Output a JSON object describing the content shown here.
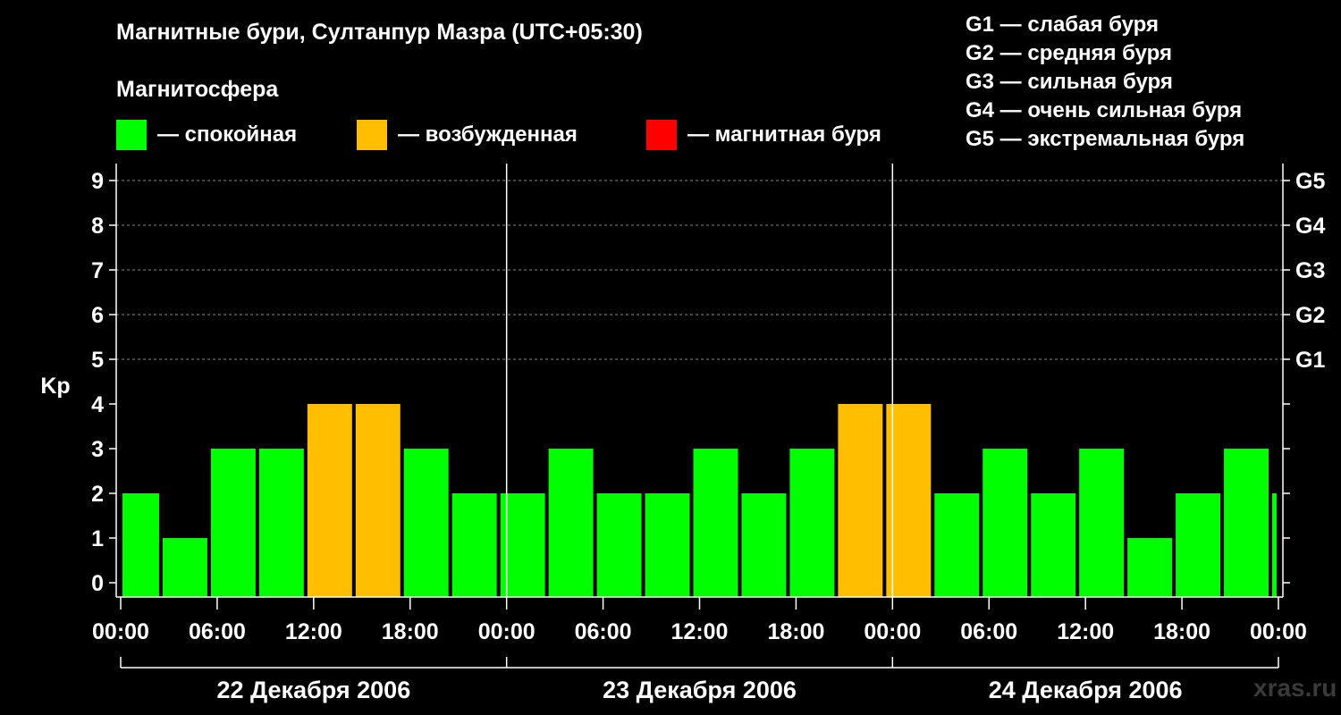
{
  "header": {
    "title": "Магнитные бури, Султанпур Мазра (UTC+05:30)",
    "subtitle": "Магнитосфера"
  },
  "legend": {
    "quiet": {
      "label": "— спокойная",
      "color": "#00ff00"
    },
    "excited": {
      "label": "— возбужденная",
      "color": "#ffbf00"
    },
    "storm": {
      "label": "— магнитная буря",
      "color": "#ff0000"
    }
  },
  "g_scale": [
    "G1 — слабая буря",
    "G2 — средняя буря",
    "G3 — сильная буря",
    "G4 — очень сильная буря",
    "G5 — экстремальная буря"
  ],
  "watermark": "xras.ru",
  "chart_data": {
    "type": "bar",
    "ylabel": "Kp",
    "ylim": [
      0,
      9
    ],
    "yticks": [
      "0",
      "1",
      "2",
      "3",
      "4",
      "5",
      "6",
      "7",
      "8",
      "9"
    ],
    "right_ticks": [
      {
        "value": 5,
        "label": "G1"
      },
      {
        "value": 6,
        "label": "G2"
      },
      {
        "value": 7,
        "label": "G3"
      },
      {
        "value": 8,
        "label": "G4"
      },
      {
        "value": 9,
        "label": "G5"
      }
    ],
    "grid": true,
    "x_tick_labels": [
      "00:00",
      "06:00",
      "12:00",
      "18:00",
      "00:00",
      "06:00",
      "12:00",
      "18:00",
      "00:00",
      "06:00",
      "12:00",
      "18:00",
      "00:00"
    ],
    "day_labels": [
      "22 Декабря 2006",
      "23 Декабря 2006",
      "24 Декабря 2006"
    ],
    "bars": [
      {
        "start": "00:00",
        "end": "02:30",
        "kp": 2,
        "level": "quiet"
      },
      {
        "start": "02:30",
        "end": "05:30",
        "kp": 1,
        "level": "quiet"
      },
      {
        "start": "05:30",
        "end": "08:30",
        "kp": 3,
        "level": "quiet"
      },
      {
        "start": "08:30",
        "end": "11:30",
        "kp": 3,
        "level": "quiet"
      },
      {
        "start": "11:30",
        "end": "14:30",
        "kp": 4,
        "level": "excited"
      },
      {
        "start": "14:30",
        "end": "17:30",
        "kp": 4,
        "level": "excited"
      },
      {
        "start": "17:30",
        "end": "20:30",
        "kp": 3,
        "level": "quiet"
      },
      {
        "start": "20:30",
        "end": "23:30",
        "kp": 2,
        "level": "quiet"
      },
      {
        "start": "23:30",
        "end": "02:30",
        "kp": 2,
        "level": "quiet"
      },
      {
        "start": "02:30",
        "end": "05:30",
        "kp": 3,
        "level": "quiet"
      },
      {
        "start": "05:30",
        "end": "08:30",
        "kp": 2,
        "level": "quiet"
      },
      {
        "start": "08:30",
        "end": "11:30",
        "kp": 2,
        "level": "quiet"
      },
      {
        "start": "11:30",
        "end": "14:30",
        "kp": 3,
        "level": "quiet"
      },
      {
        "start": "14:30",
        "end": "17:30",
        "kp": 2,
        "level": "quiet"
      },
      {
        "start": "17:30",
        "end": "20:30",
        "kp": 3,
        "level": "quiet"
      },
      {
        "start": "20:30",
        "end": "23:30",
        "kp": 4,
        "level": "excited"
      },
      {
        "start": "23:30",
        "end": "02:30",
        "kp": 4,
        "level": "excited"
      },
      {
        "start": "02:30",
        "end": "05:30",
        "kp": 2,
        "level": "quiet"
      },
      {
        "start": "05:30",
        "end": "08:30",
        "kp": 3,
        "level": "quiet"
      },
      {
        "start": "08:30",
        "end": "11:30",
        "kp": 2,
        "level": "quiet"
      },
      {
        "start": "11:30",
        "end": "14:30",
        "kp": 3,
        "level": "quiet"
      },
      {
        "start": "14:30",
        "end": "17:30",
        "kp": 1,
        "level": "quiet"
      },
      {
        "start": "17:30",
        "end": "20:30",
        "kp": 2,
        "level": "quiet"
      },
      {
        "start": "20:30",
        "end": "23:30",
        "kp": 3,
        "level": "quiet"
      },
      {
        "start": "23:30",
        "end": "00:00",
        "kp": 2,
        "level": "quiet"
      }
    ]
  }
}
